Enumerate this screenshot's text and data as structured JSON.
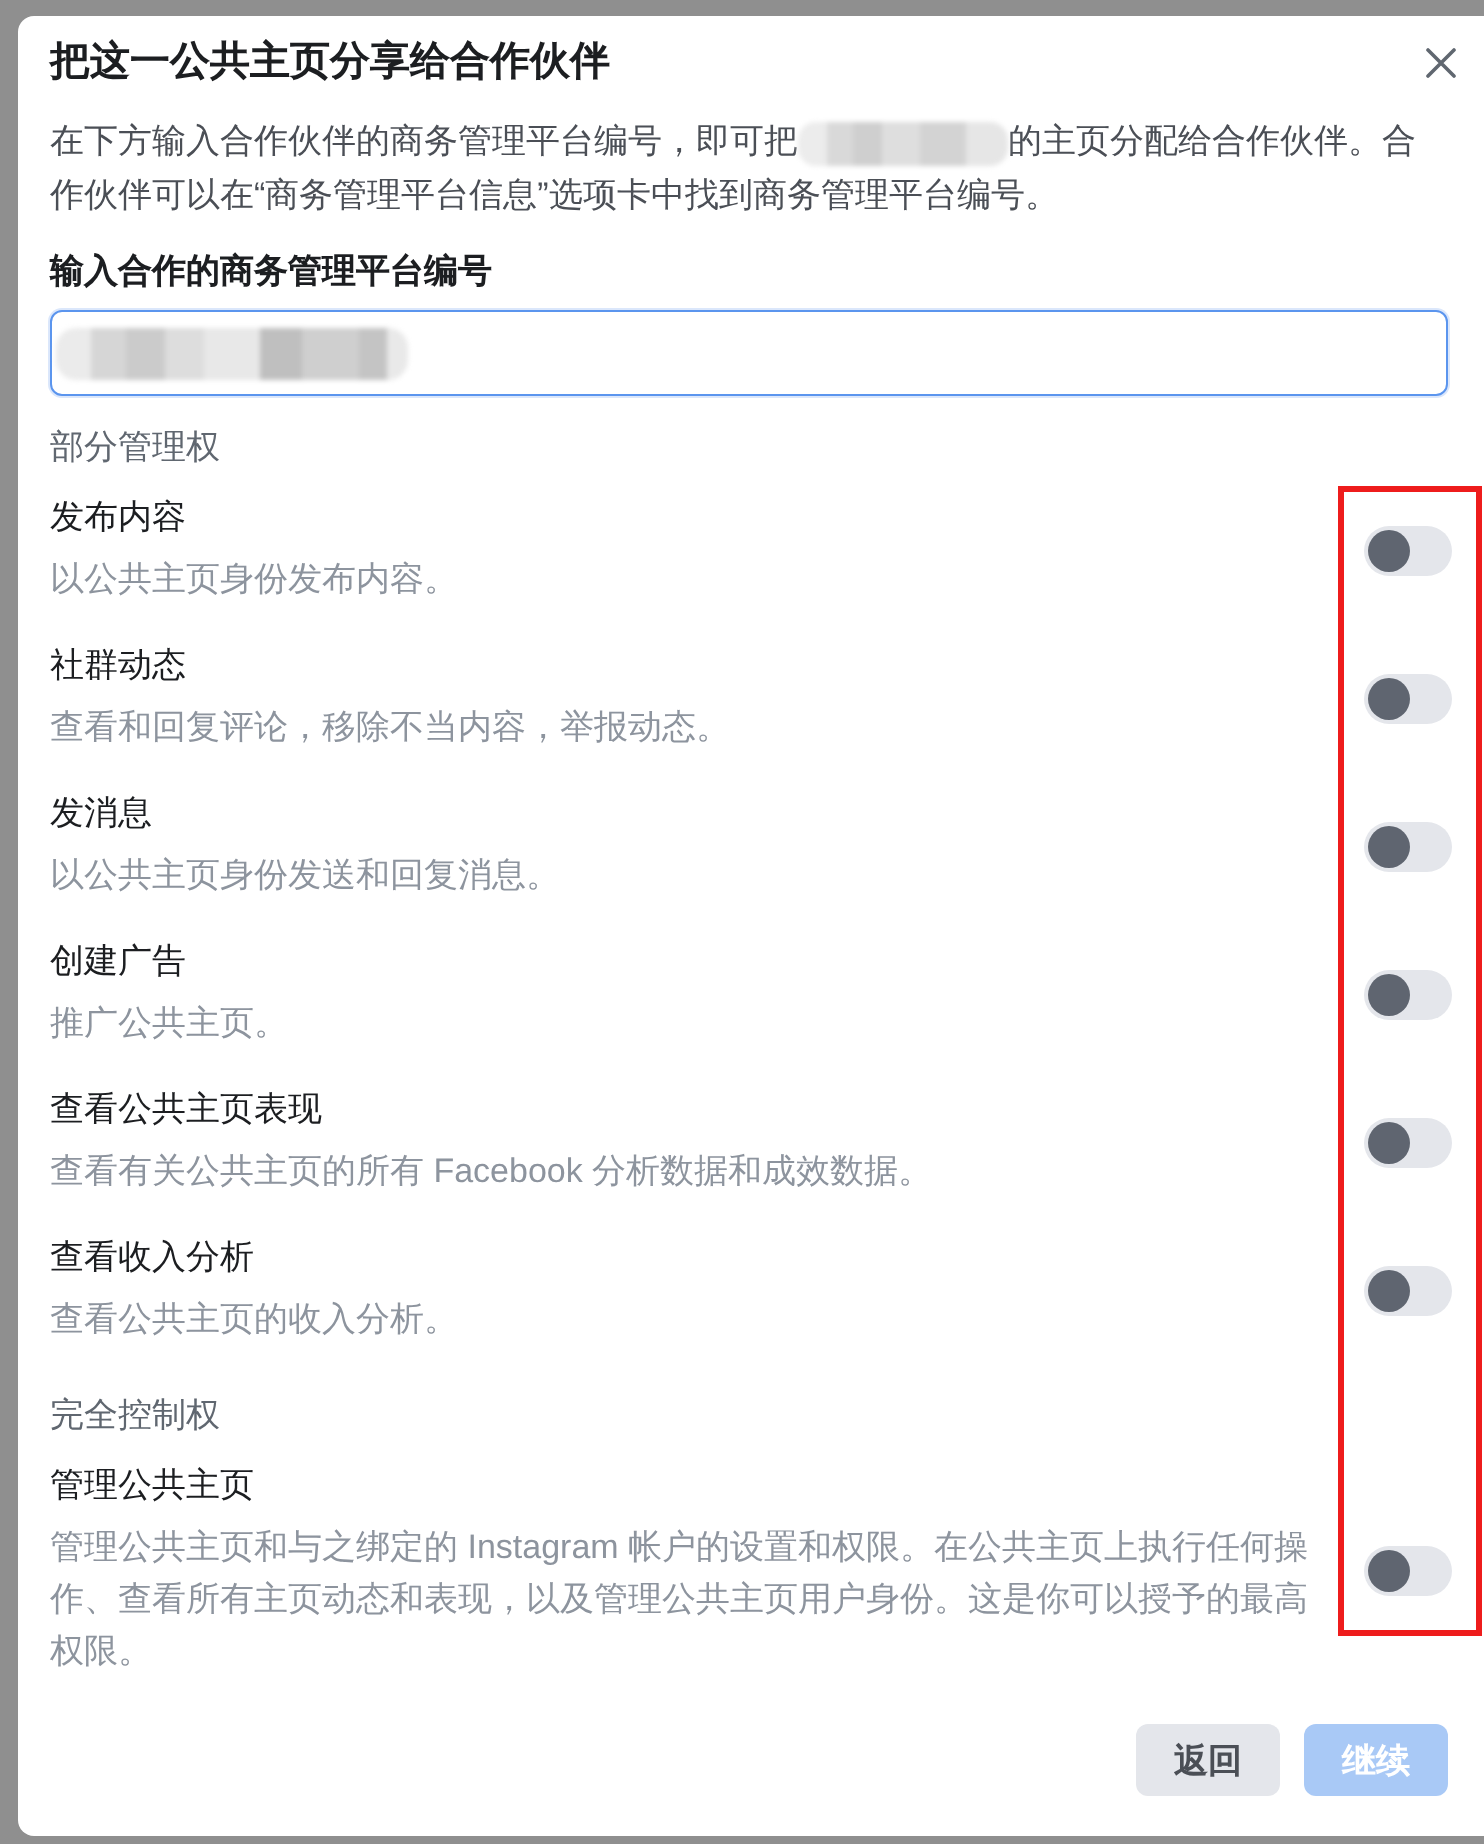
{
  "title": "把这一公共主页分享给合作伙伴",
  "description": {
    "before": "在下方输入合作伙伴的商务管理平台编号，即可把",
    "redacted": true,
    "after": "的主页分配给合作伙伴。合作伙伴可以在“商务管理平台信息”选项卡中找到商务管理平台编号。"
  },
  "partner_id_field": {
    "label": "输入合作的商务管理平台编号",
    "value_redacted": true,
    "focused": true
  },
  "permission_groups": [
    {
      "heading": "部分管理权",
      "permissions": [
        {
          "title": "发布内容",
          "description": "以公共主页身份发布内容。",
          "on": false
        },
        {
          "title": "社群动态",
          "description": "查看和回复评论，移除不当内容，举报动态。",
          "on": false
        },
        {
          "title": "发消息",
          "description": "以公共主页身份发送和回复消息。",
          "on": false
        },
        {
          "title": "创建广告",
          "description": "推广公共主页。",
          "on": false
        },
        {
          "title": "查看公共主页表现",
          "description": "查看有关公共主页的所有 Facebook 分析数据和成效数据。",
          "on": false
        },
        {
          "title": "查看收入分析",
          "description": "查看公共主页的收入分析。",
          "on": false
        }
      ]
    },
    {
      "heading": "完全控制权",
      "permissions": [
        {
          "title": "管理公共主页",
          "description": "管理公共主页和与之绑定的 Instagram 帐户的设置和权限。在公共主页上执行任何操作、查看所有主页动态和表现，以及管理公共主页用户身份。这是你可以授予的最高权限。",
          "on": false
        }
      ]
    }
  ],
  "toggle_highlight": true,
  "buttons": [
    {
      "label": "返回",
      "kind": "secondary",
      "disabled": false
    },
    {
      "label": "继续",
      "kind": "primary",
      "disabled": true
    }
  ]
}
